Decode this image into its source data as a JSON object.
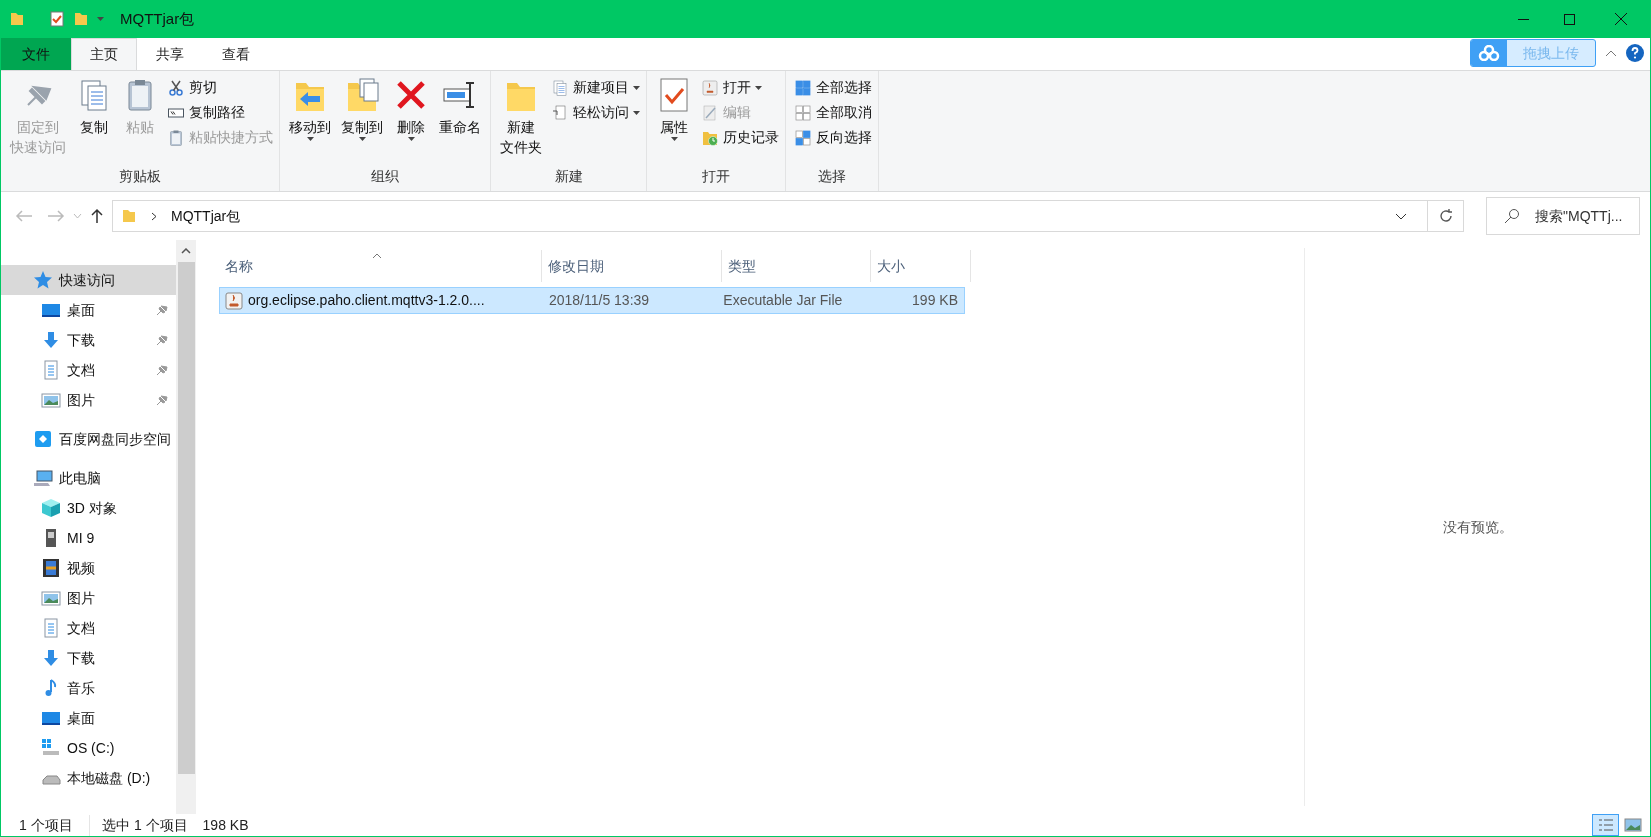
{
  "window": {
    "title": "MQTTjar包"
  },
  "ribbon_tabs": [
    {
      "label": "文件",
      "kind": "file",
      "selected": false
    },
    {
      "label": "主页",
      "kind": "tab",
      "selected": true
    },
    {
      "label": "共享",
      "kind": "tab",
      "selected": false
    },
    {
      "label": "查看",
      "kind": "tab",
      "selected": false
    }
  ],
  "upload_button": {
    "label": "拖拽上传"
  },
  "ribbon_groups": [
    {
      "label": "剪贴板",
      "large_buttons": [
        {
          "lines": [
            "固定到",
            "快速访问"
          ],
          "kind": "pin",
          "disabled": true,
          "dropdown": false
        },
        {
          "lines": [
            "复制"
          ],
          "kind": "copy",
          "disabled": false,
          "dropdown": false
        },
        {
          "lines": [
            "粘贴"
          ],
          "kind": "paste",
          "disabled": true,
          "dropdown": false
        }
      ],
      "small_buttons": [
        {
          "label": "剪切",
          "kind": "cut",
          "disabled": false,
          "dropdown": false
        },
        {
          "label": "复制路径",
          "kind": "copy-path",
          "disabled": false,
          "dropdown": false
        },
        {
          "label": "粘贴快捷方式",
          "kind": "paste-shortcut",
          "disabled": true,
          "dropdown": false
        }
      ]
    },
    {
      "label": "组织",
      "large_buttons": [
        {
          "lines": [
            "移动到"
          ],
          "kind": "move",
          "disabled": false,
          "dropdown": true
        },
        {
          "lines": [
            "复制到"
          ],
          "kind": "copy-to",
          "disabled": false,
          "dropdown": true
        },
        {
          "lines": [
            "删除"
          ],
          "kind": "delete",
          "disabled": false,
          "dropdown": true
        },
        {
          "lines": [
            "重命名"
          ],
          "kind": "rename",
          "disabled": false,
          "dropdown": false
        }
      ]
    },
    {
      "label": "新建",
      "large_buttons": [
        {
          "lines": [
            "新建",
            "文件夹"
          ],
          "kind": "new-folder",
          "disabled": false,
          "dropdown": false
        }
      ],
      "small_buttons": [
        {
          "label": "新建项目",
          "kind": "new-item",
          "disabled": false,
          "dropdown": true
        },
        {
          "label": "轻松访问",
          "kind": "easy-access",
          "disabled": false,
          "dropdown": true
        }
      ]
    },
    {
      "label": "打开",
      "large_buttons": [
        {
          "lines": [
            "属性"
          ],
          "kind": "properties",
          "disabled": false,
          "dropdown": true
        }
      ],
      "small_buttons": [
        {
          "label": "打开",
          "kind": "open",
          "disabled": false,
          "dropdown": true
        },
        {
          "label": "编辑",
          "kind": "edit",
          "disabled": true,
          "dropdown": false
        },
        {
          "label": "历史记录",
          "kind": "history",
          "disabled": false,
          "dropdown": false
        }
      ]
    },
    {
      "label": "选择",
      "small_buttons": [
        {
          "label": "全部选择",
          "kind": "select-all",
          "disabled": false,
          "dropdown": false
        },
        {
          "label": "全部取消",
          "kind": "select-none",
          "disabled": false,
          "dropdown": false
        },
        {
          "label": "反向选择",
          "kind": "invert",
          "disabled": false,
          "dropdown": false
        }
      ]
    }
  ],
  "address_bar": {
    "path": "MQTTjar包"
  },
  "search": {
    "placeholder": "搜索\"MQTTj..."
  },
  "sidebar": [
    {
      "label": "快速访问",
      "kind": "star",
      "selected": true,
      "children": [
        {
          "label": "桌面",
          "kind": "desktop",
          "pinned": true,
          "selected": false
        },
        {
          "label": "下载",
          "kind": "download",
          "pinned": true,
          "selected": false
        },
        {
          "label": "文档",
          "kind": "document",
          "pinned": true,
          "selected": false
        },
        {
          "label": "图片",
          "kind": "picture",
          "pinned": true,
          "selected": false
        }
      ]
    },
    {
      "label": "百度网盘同步空间",
      "kind": "cloud",
      "selected": false
    },
    {
      "label": "此电脑",
      "kind": "computer",
      "selected": false,
      "children": [
        {
          "label": "3D 对象",
          "kind": "cube",
          "pinned": false,
          "selected": false
        },
        {
          "label": "MI 9",
          "kind": "phone",
          "pinned": false,
          "selected": false
        },
        {
          "label": "视频",
          "kind": "video",
          "pinned": false,
          "selected": false
        },
        {
          "label": "图片",
          "kind": "picture",
          "pinned": false,
          "selected": false
        },
        {
          "label": "文档",
          "kind": "document",
          "pinned": false,
          "selected": false
        },
        {
          "label": "下载",
          "kind": "download",
          "pinned": false,
          "selected": false
        },
        {
          "label": "音乐",
          "kind": "music",
          "pinned": false,
          "selected": false
        },
        {
          "label": "桌面",
          "kind": "desktop",
          "pinned": false,
          "selected": false
        },
        {
          "label": "OS (C:)",
          "kind": "windows-drive",
          "pinned": false,
          "selected": false
        },
        {
          "label": "本地磁盘 (D:)",
          "kind": "drive",
          "pinned": false,
          "selected": false
        }
      ]
    }
  ],
  "table": {
    "columns": [
      "名称",
      "修改日期",
      "类型",
      "大小"
    ],
    "rows": [
      {
        "cells": [
          "org.eclipse.paho.client.mqttv3-1.2.0....",
          "2018/11/5 13:39",
          "Executable Jar File",
          "199 KB"
        ],
        "selected": true
      }
    ]
  },
  "preview": {
    "text": "没有预览。"
  },
  "status_bar": {
    "count": "1 个项目",
    "selection": "选中 1 个项目",
    "size": "198 KB"
  },
  "view_modes": [
    {
      "kind": "details",
      "selected": true
    },
    {
      "kind": "tiles",
      "selected": false
    }
  ]
}
